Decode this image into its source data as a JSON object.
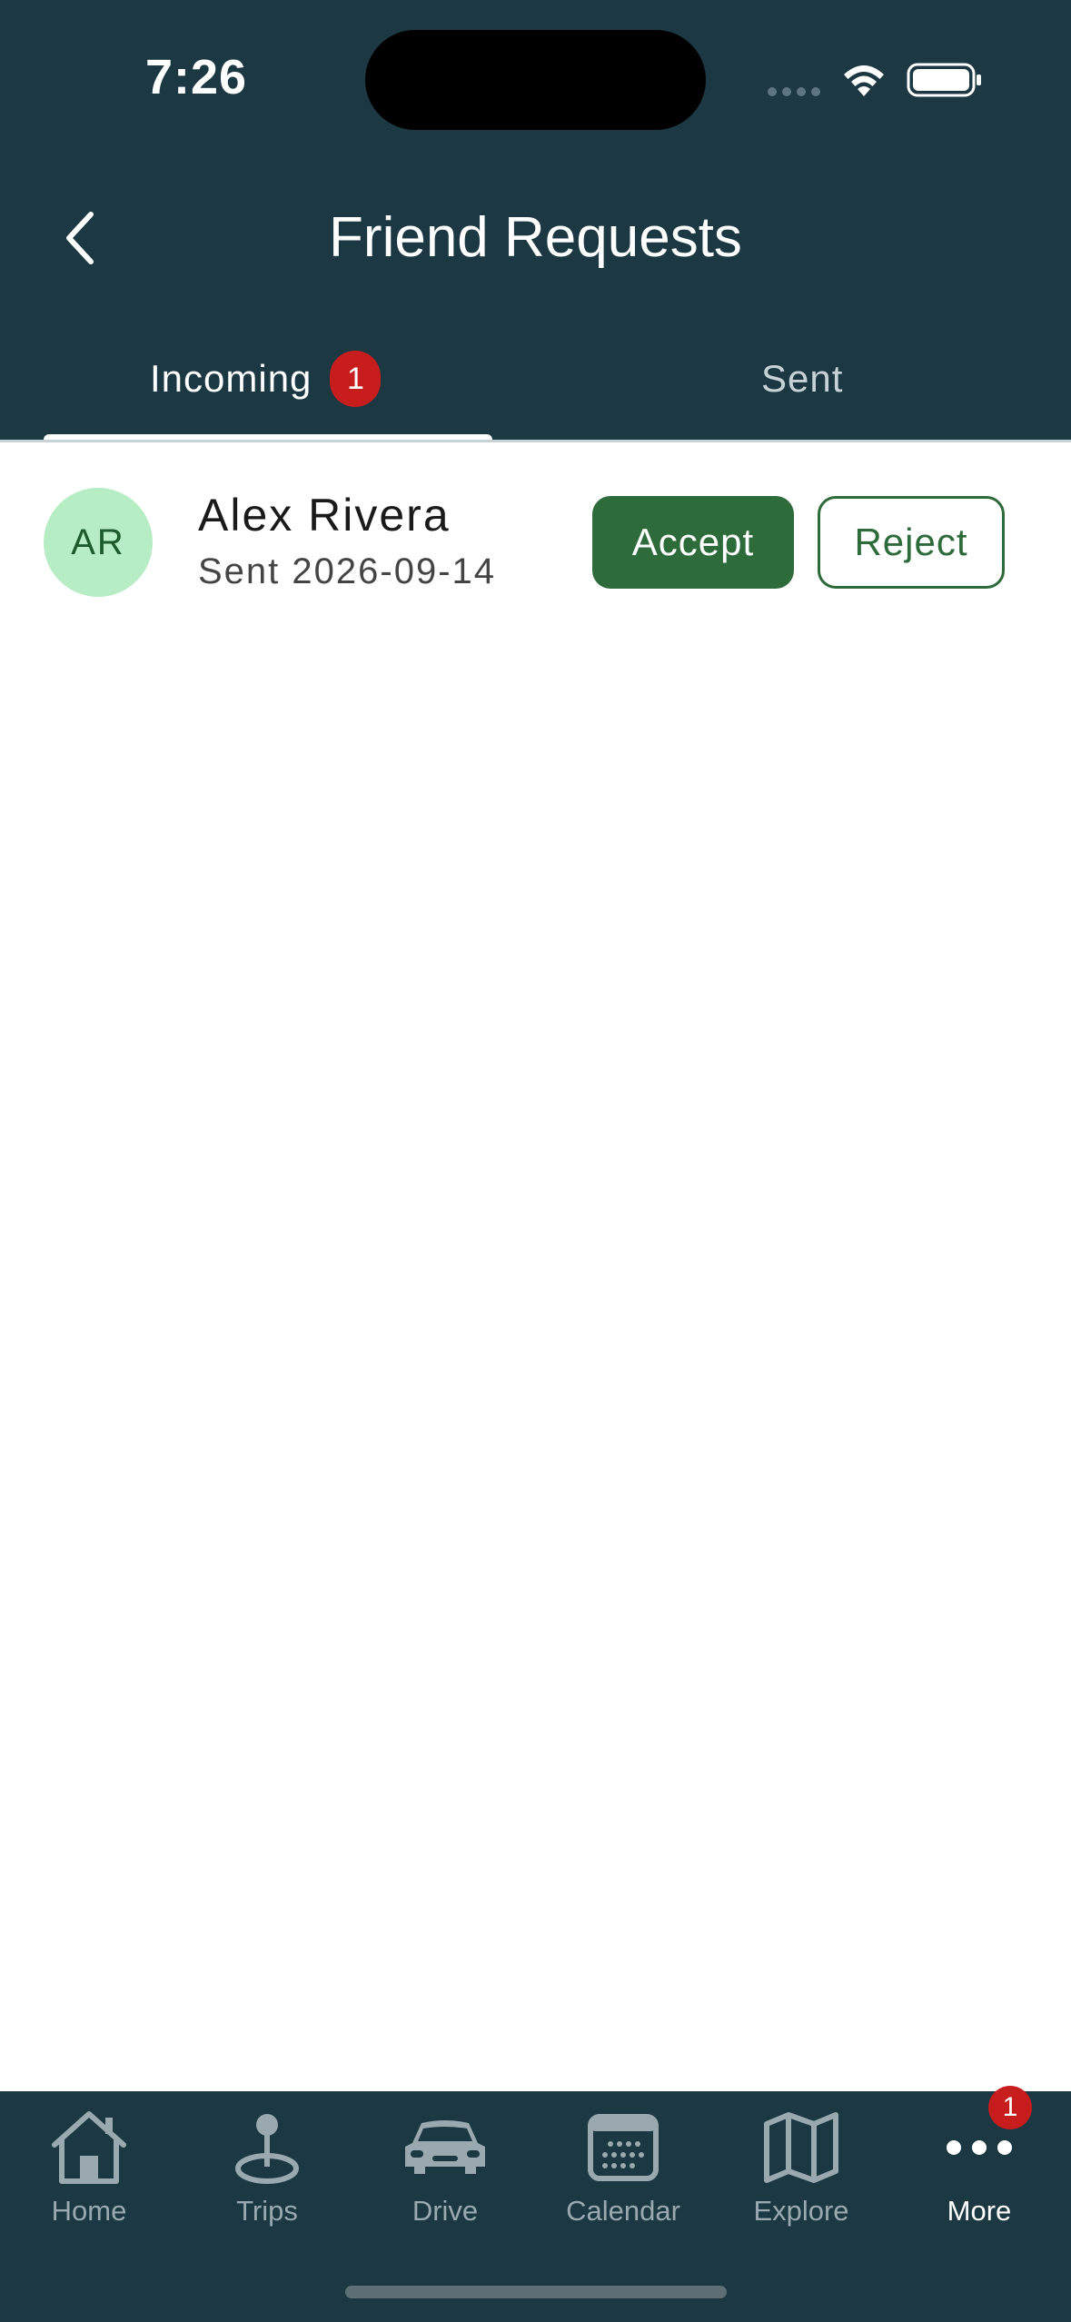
{
  "status_bar": {
    "time": "7:26"
  },
  "header": {
    "title": "Friend Requests",
    "tabs": [
      {
        "label": "Incoming",
        "badge": "1",
        "selected": true
      },
      {
        "label": "Sent",
        "selected": false
      }
    ]
  },
  "requests": [
    {
      "initials": "AR",
      "name": "Alex Rivera",
      "sent": "Sent 2026-09-14",
      "accept_label": "Accept",
      "reject_label": "Reject"
    }
  ],
  "tabbar": {
    "items": [
      {
        "label": "Home",
        "icon": "home-icon"
      },
      {
        "label": "Trips",
        "icon": "location-pin-icon"
      },
      {
        "label": "Drive",
        "icon": "car-icon"
      },
      {
        "label": "Calendar",
        "icon": "calendar-icon"
      },
      {
        "label": "Explore",
        "icon": "map-icon"
      },
      {
        "label": "More",
        "icon": "more-icon",
        "badge": "1",
        "active": true
      }
    ]
  },
  "colors": {
    "header_bg": "#1b3843",
    "accent_green": "#2e6b3b",
    "badge_red": "#c81d1d",
    "avatar_bg": "#b7edc4"
  }
}
